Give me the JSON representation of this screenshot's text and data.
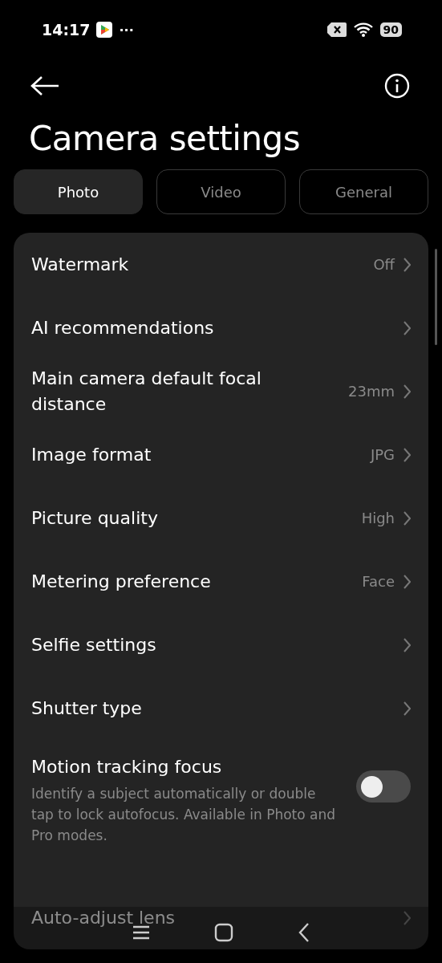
{
  "status_bar": {
    "time": "14:17",
    "more": "···",
    "battery": "90"
  },
  "title": "Camera settings",
  "tabs": [
    {
      "label": "Photo",
      "selected": true
    },
    {
      "label": "Video",
      "selected": false
    },
    {
      "label": "General",
      "selected": false
    }
  ],
  "rows": [
    {
      "kind": "nav",
      "label": "Watermark",
      "value": "Off"
    },
    {
      "kind": "nav",
      "label": "AI recommendations"
    },
    {
      "kind": "nav",
      "label": "Main camera default focal distance",
      "value": "23mm"
    },
    {
      "kind": "nav",
      "label": "Image format",
      "value": "JPG"
    },
    {
      "kind": "nav",
      "label": "Picture quality",
      "value": "High"
    },
    {
      "kind": "nav",
      "label": "Metering preference",
      "value": "Face"
    },
    {
      "kind": "nav",
      "label": "Selfie settings"
    },
    {
      "kind": "nav",
      "label": "Shutter type"
    },
    {
      "kind": "toggle",
      "label": "Motion tracking focus",
      "description": "Identify a subject automatically or double tap to lock autofocus. Available in Photo and Pro modes.",
      "on": false
    },
    {
      "kind": "nav",
      "label": "Auto-adjust lens"
    }
  ]
}
